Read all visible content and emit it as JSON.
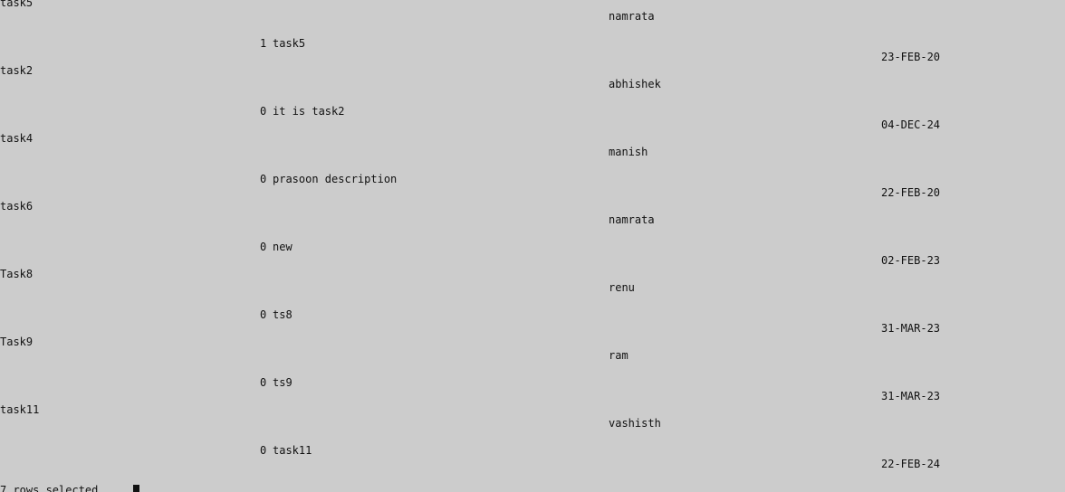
{
  "terminal": {
    "rows": [
      {
        "task_name": "task5",
        "assignee": "namrata",
        "status_flag": "1",
        "description": "task5",
        "due_date": "23-FEB-20"
      },
      {
        "task_name": "task2",
        "assignee": "abhishek",
        "status_flag": "0",
        "description": "it is task2",
        "due_date": "04-DEC-24"
      },
      {
        "task_name": "task4",
        "assignee": "manish",
        "status_flag": "0",
        "description": "prasoon description",
        "due_date": "22-FEB-20"
      },
      {
        "task_name": "task6",
        "assignee": "namrata",
        "status_flag": "0",
        "description": "new",
        "due_date": "02-FEB-23"
      },
      {
        "task_name": "Task8",
        "assignee": "renu",
        "status_flag": "0",
        "description": "ts8",
        "due_date": "31-MAR-23"
      },
      {
        "task_name": "Task9",
        "assignee": "ram",
        "status_flag": "0",
        "description": "ts9",
        "due_date": "31-MAR-23"
      },
      {
        "task_name": "task11",
        "assignee": "vashisth",
        "status_flag": "0",
        "description": "task11",
        "due_date": "22-FEB-24"
      }
    ],
    "footer": "7 rows selected."
  },
  "colors": {
    "background": "#cccccc",
    "text": "#111111"
  }
}
